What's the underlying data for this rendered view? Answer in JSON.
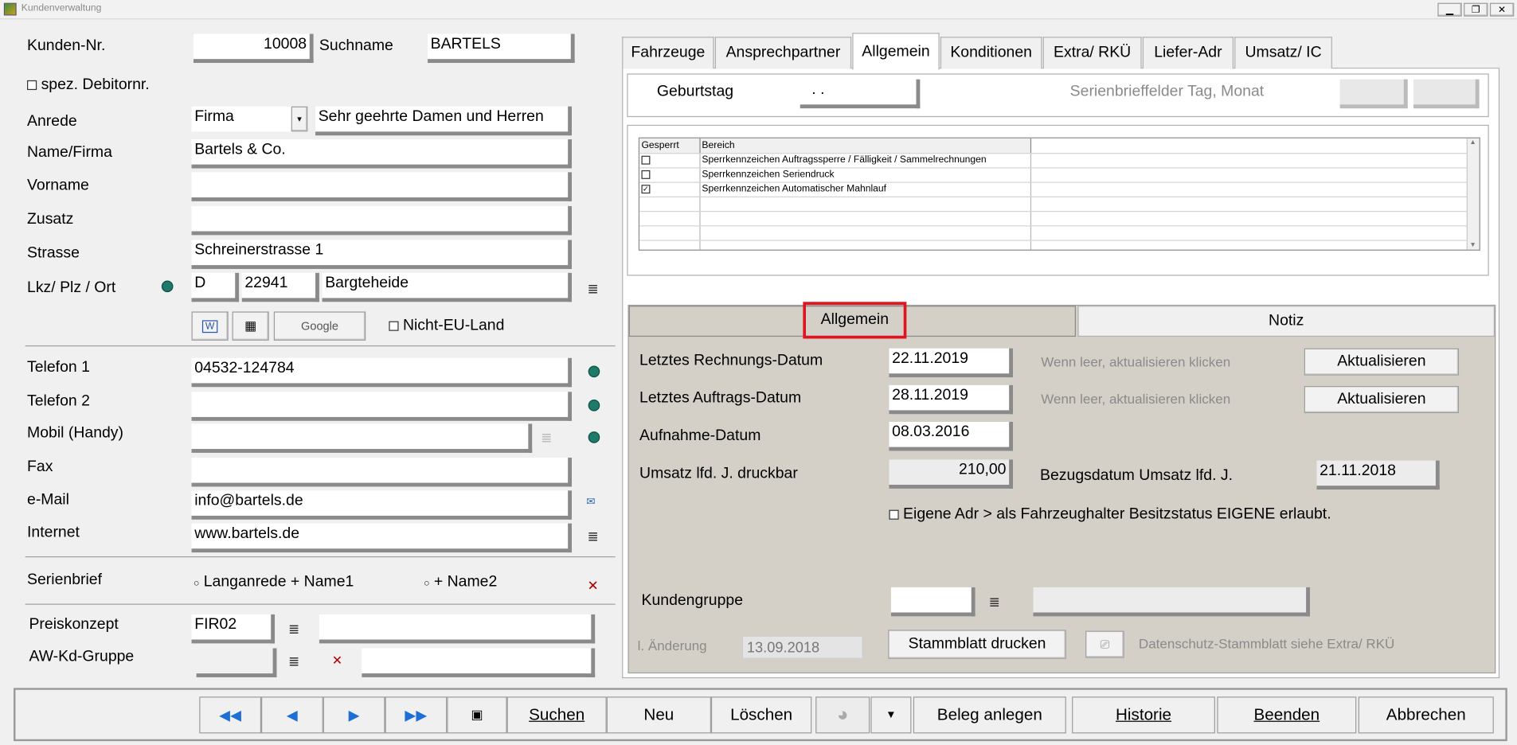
{
  "window": {
    "title": "Kundenverwaltung"
  },
  "left": {
    "kunden_nr_label": "Kunden-Nr.",
    "kunden_nr": "10008",
    "suchname_label": "Suchname",
    "suchname": "BARTELS",
    "spez_debitor_label": "spez. Debitornr.",
    "anrede_label": "Anrede",
    "anrede_value": "Firma",
    "anrede_text": "Sehr geehrte Damen und Herren",
    "name_label": "Name/Firma",
    "name_value": "Bartels & Co.",
    "vorname_label": "Vorname",
    "vorname_value": "",
    "zusatz_label": "Zusatz",
    "zusatz_value": "",
    "strasse_label": "Strasse",
    "strasse_value": "Schreinerstrasse 1",
    "lkz_label": "Lkz/ Plz / Ort",
    "lkz": "D",
    "plz": "22941",
    "ort": "Bargteheide",
    "google_label": "Google",
    "nicht_eu_label": "Nicht-EU-Land",
    "telefon1_label": "Telefon 1",
    "telefon1": "04532-124784",
    "telefon2_label": "Telefon 2",
    "telefon2": "",
    "mobil_label": "Mobil (Handy)",
    "mobil": "",
    "fax_label": "Fax",
    "fax": "",
    "email_label": "e-Mail",
    "email": "info@bartels.de",
    "internet_label": "Internet",
    "internet": "www.bartels.de",
    "serienbrief_label": "Serienbrief",
    "radio1": "Langanrede + Name1",
    "radio2": "+ Name2",
    "preiskonzept_label": "Preiskonzept",
    "preiskonzept": "FIR02",
    "preiskonzept_desc": "",
    "awkd_label": "AW-Kd-Gruppe",
    "awkd": "",
    "awkd_desc": ""
  },
  "tabs": [
    {
      "label": "Fahrzeuge"
    },
    {
      "label": "Ansprechpartner"
    },
    {
      "label": "Allgemein"
    },
    {
      "label": "Konditionen"
    },
    {
      "label": "Extra/ RKÜ"
    },
    {
      "label": "Liefer-Adr"
    },
    {
      "label": "Umsatz/ IC"
    }
  ],
  "allgemein": {
    "geburtstag_label": "Geburtstag",
    "geburtstag": ". .",
    "serienbrief_tag_label": "Serienbrieffelder Tag, Monat",
    "grid_headers": [
      "Gesperrt",
      "Bereich",
      ""
    ],
    "grid_rows": [
      {
        "checked": false,
        "bereich": "Sperrkennzeichen Auftragssperre / Fälligkeit / Sammelrechnungen"
      },
      {
        "checked": false,
        "bereich": "Sperrkennzeichen Seriendruck"
      },
      {
        "checked": true,
        "bereich": "Sperrkennzeichen Automatischer Mahnlauf"
      }
    ]
  },
  "subtabs": {
    "allgemein": "Allgemein",
    "notiz": "Notiz"
  },
  "details": {
    "letzte_rechnung_label": "Letztes Rechnungs-Datum",
    "letzte_rechnung": "22.11.2019",
    "letzter_auftrag_label": "Letztes Auftrags-Datum",
    "letzter_auftrag": "28.11.2019",
    "hint": "Wenn leer, aktualisieren klicken",
    "aktualisieren": "Aktualisieren",
    "aufnahme_label": "Aufnahme-Datum",
    "aufnahme": "08.03.2016",
    "umsatz_label": "Umsatz lfd. J. druckbar",
    "umsatz": "210,00",
    "bezugsdatum_label": "Bezugsdatum Umsatz lfd. J.",
    "bezugsdatum": "21.11.2018",
    "eigene_adr_label": "Eigene Adr > als Fahrzeughalter Besitzstatus EIGENE erlaubt.",
    "kundengruppe_label": "Kundengruppe",
    "aenderung_label": "l. Änderung",
    "aenderung": "13.09.2018",
    "stammblatt": "Stammblatt drucken",
    "datenschutz": "Datenschutz-Stammblatt siehe Extra/ RKÜ"
  },
  "toolbar": {
    "suchen": "Suchen",
    "neu": "Neu",
    "loeschen": "Löschen",
    "beleg": "Beleg anlegen",
    "historie": "Historie",
    "beenden": "Beenden",
    "abbrechen": "Abbrechen"
  }
}
